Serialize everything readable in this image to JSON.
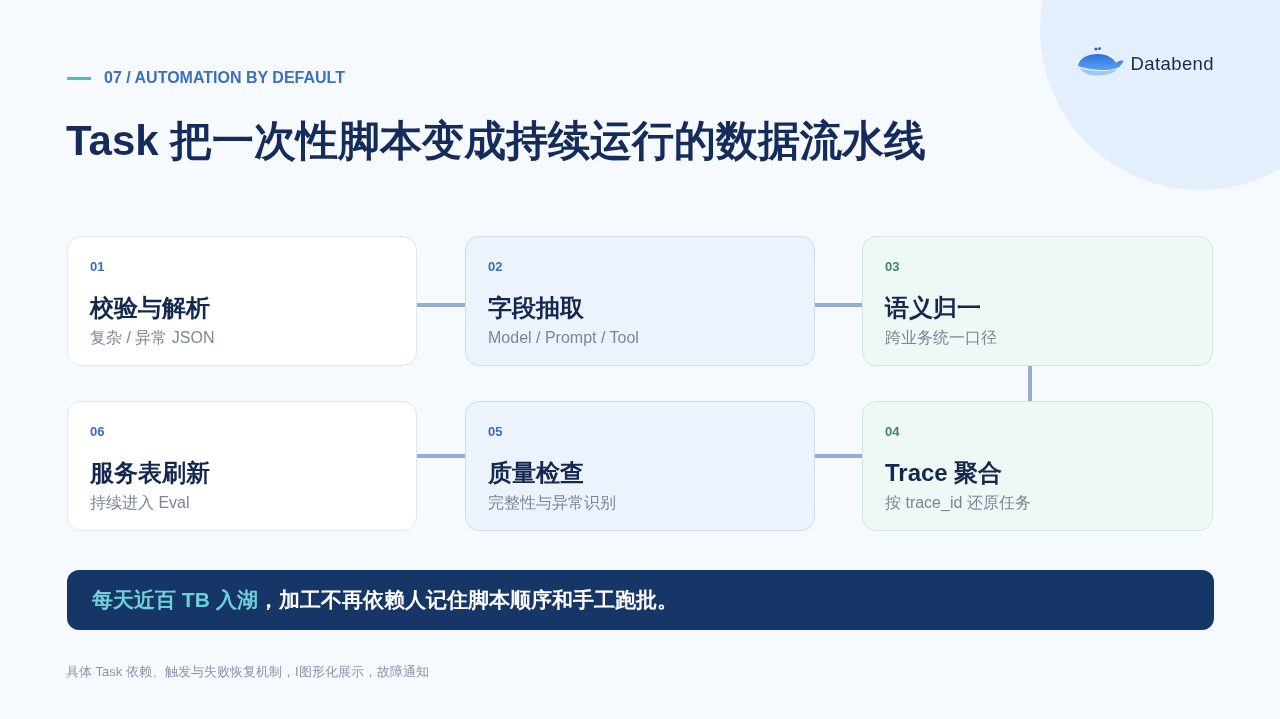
{
  "header": {
    "eyebrow": "07 / AUTOMATION BY DEFAULT",
    "title": "Task 把一次性脚本变成持续运行的数据流水线"
  },
  "logo": {
    "name": "Databend"
  },
  "steps": [
    {
      "number": "01",
      "title": "校验与解析",
      "subtitle": "复杂 / 异常 JSON",
      "kind": "plain"
    },
    {
      "number": "02",
      "title": "字段抽取",
      "subtitle": "Model / Prompt / Tool",
      "kind": "tinted"
    },
    {
      "number": "03",
      "title": "语义归一",
      "subtitle": "跨业务统一口径",
      "kind": "mint"
    },
    {
      "number": "06",
      "title": "服务表刷新",
      "subtitle": "持续进入 Eval",
      "kind": "plain"
    },
    {
      "number": "05",
      "title": "质量检查",
      "subtitle": "完整性与异常识别",
      "kind": "tinted"
    },
    {
      "number": "04",
      "title": "Trace 聚合",
      "subtitle": "按 trace_id 还原任务",
      "kind": "mint"
    }
  ],
  "banner": {
    "highlight": "每天近百 TB 入湖",
    "text": "，加工不再依赖人记住脚本顺序和手工跑批。"
  },
  "footnote": "具体 Task 依赖、触发与失败恢复机制，I图形化展示，故障通知"
}
